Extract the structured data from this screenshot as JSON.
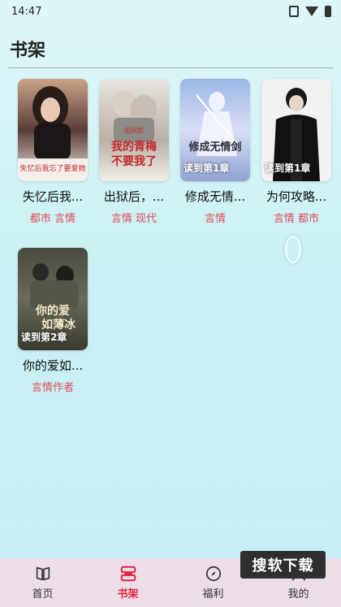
{
  "status_bar": {
    "time": "14:47"
  },
  "page": {
    "title": "书架"
  },
  "books": [
    {
      "title": "失忆后我...",
      "tags": "都市 言情",
      "progress": ""
    },
    {
      "title": "出狱后，...",
      "tags": "言情 现代",
      "progress": ""
    },
    {
      "title": "修成无情...",
      "tags": "言情",
      "progress": "读到第1章"
    },
    {
      "title": "为何攻略...",
      "tags": "言情 都市",
      "progress": "读到第1章"
    },
    {
      "title": "你的爱如...",
      "tags": "言情作者",
      "progress": "读到第2章"
    }
  ],
  "covers": {
    "c1_text": "失忆后我忘了要爱她",
    "c2_text_top": "出狱后",
    "c2_text_main": "我的青梅不要我了",
    "c3_text": "修成无情剑",
    "c5_text_top": "你的爱",
    "c5_text_bottom": "如薄冰"
  },
  "bottom_nav": {
    "items": [
      {
        "label": "首页",
        "icon": "book-icon"
      },
      {
        "label": "书架",
        "icon": "bookshelf-icon"
      },
      {
        "label": "福利",
        "icon": "compass-icon"
      },
      {
        "label": "我的",
        "icon": "user-icon"
      }
    ],
    "active_color": "#e2253c"
  },
  "watermark": "搜软下载"
}
